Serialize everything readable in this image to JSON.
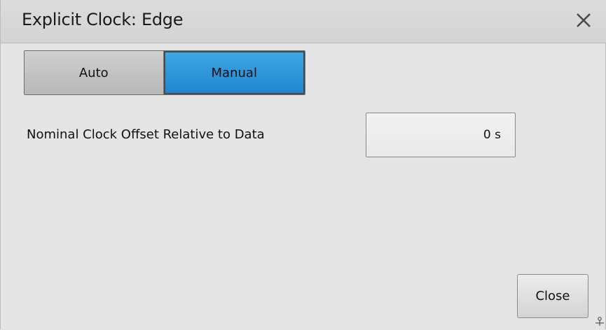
{
  "window": {
    "title": "Explicit Clock: Edge",
    "close_icon": "close-icon"
  },
  "mode_toggle": {
    "options": [
      {
        "label": "Auto",
        "selected": false
      },
      {
        "label": "Manual",
        "selected": true
      }
    ],
    "selected_color": "#2b95d9"
  },
  "offset_field": {
    "label": "Nominal Clock Offset Relative to Data",
    "value": "0 s"
  },
  "footer": {
    "close_label": "Close",
    "resize_icon": "resize-grip-icon"
  }
}
